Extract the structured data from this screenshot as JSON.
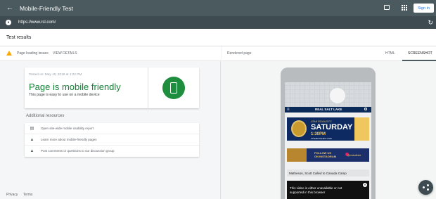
{
  "header": {
    "back_icon": "arrow-left-icon",
    "title": "Mobile-Friendly Test",
    "signin_label": "Sign in"
  },
  "urlbar": {
    "url": "https://www.rsl.com/"
  },
  "results": {
    "title": "Test results"
  },
  "status": {
    "text": "Page loading issues",
    "view_details": "VIEW DETAILS"
  },
  "card": {
    "tested": "Tested on: May 10, 2019 at 1:22 PM",
    "headline": "Page is mobile friendly",
    "description": "This page is easy to use on a mobile device"
  },
  "additional": {
    "title": "Additional resources",
    "items": [
      {
        "icon": "report-icon",
        "label": "Open site-wide mobile usability report"
      },
      {
        "icon": "school-icon",
        "label": "Learn more about mobile-friendly pages"
      },
      {
        "icon": "school-icon",
        "label": "Post comments or questions to our discussion group"
      }
    ]
  },
  "footer": {
    "privacy": "Privacy",
    "terms": "Terms"
  },
  "rendered": {
    "label": "Rendered page",
    "tabs": [
      "HTML",
      "SCREENSHOT"
    ],
    "active_tab": "SCREENSHOT"
  },
  "preview": {
    "brand": "REAL SALT LAKE",
    "ad1": {
      "sub": "UTAH ROYALS FC",
      "big": "SATURDAY",
      "time": "1:30PM",
      "site": "UTAHROYALSFC.COM"
    },
    "ad2": {
      "line1": "FOLLOW US",
      "line2": "ON INSTAGRAM",
      "handle": "@realsaltlake"
    },
    "news": "Matheson, Scott Called to Canada Camp",
    "video_line1": "This video is either unavailable or not",
    "video_line2": "supported in this browser"
  },
  "colors": {
    "accent_green": "#188038",
    "topbar": "#4a5a5f",
    "link_blue": "#1a73e8",
    "warning": "#f9ab00"
  }
}
